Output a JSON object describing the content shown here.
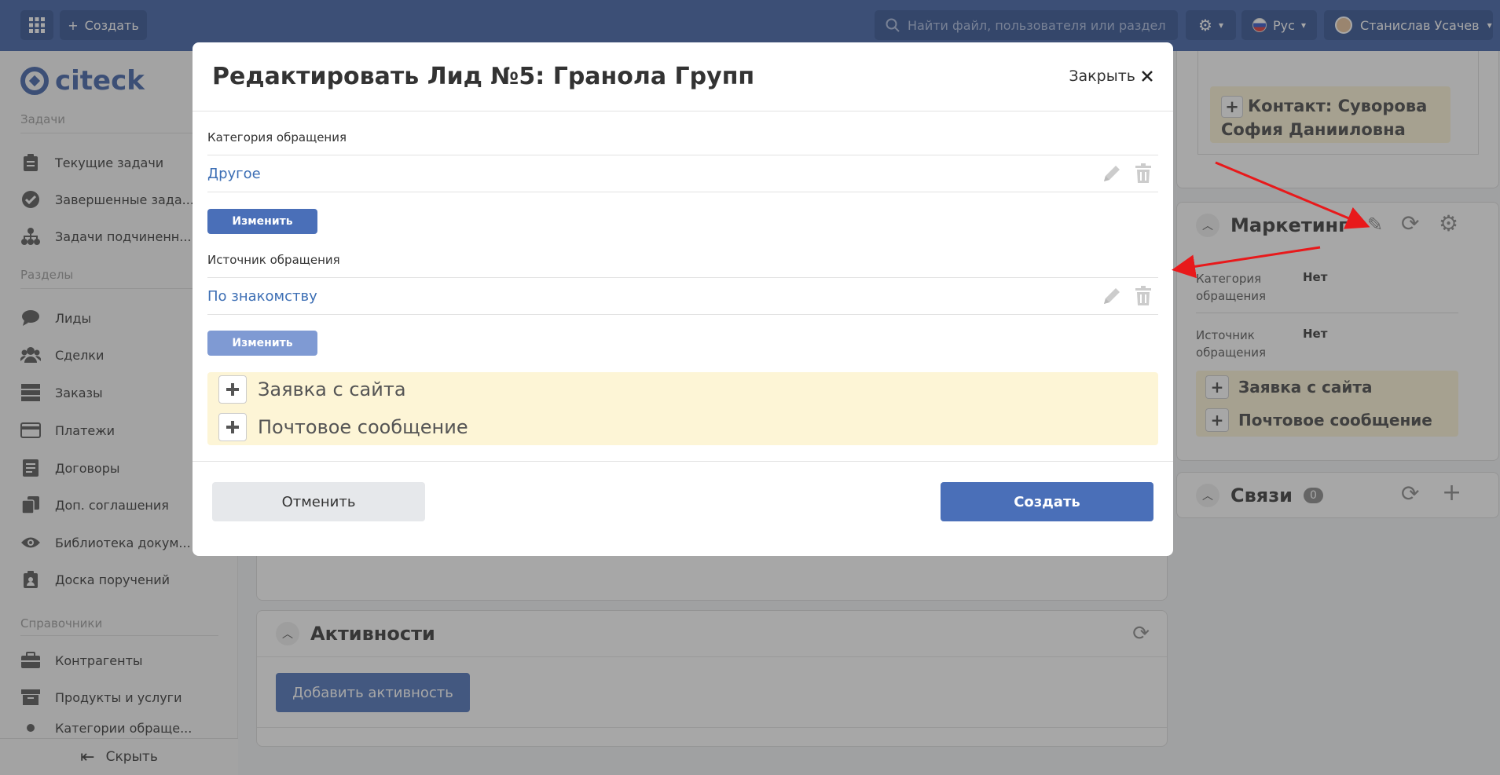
{
  "topbar": {
    "create_label": "Создать",
    "search_placeholder": "Найти файл, пользователя или раздел",
    "lang_label": "Рус",
    "user_name": "Станислав Усачев"
  },
  "sidebar": {
    "logo_text": "citeck",
    "heading_tasks": "Задачи",
    "heading_sections": "Разделы",
    "heading_refs": "Справочники",
    "items": [
      {
        "label": "Текущие задачи"
      },
      {
        "label": "Завершенные зада..."
      },
      {
        "label": "Задачи подчиненн..."
      },
      {
        "label": "Лиды"
      },
      {
        "label": "Сделки"
      },
      {
        "label": "Заказы"
      },
      {
        "label": "Платежи"
      },
      {
        "label": "Договоры"
      },
      {
        "label": "Доп. соглашения"
      },
      {
        "label": "Библиотека докум..."
      },
      {
        "label": "Доска поручений"
      },
      {
        "label": "Контрагенты"
      },
      {
        "label": "Продукты и услуги"
      },
      {
        "label": "Категории обраще..."
      }
    ],
    "hide_label": "Скрыть"
  },
  "background": {
    "activities_title": "Активности",
    "add_activity_label": "Добавить активность",
    "contact_text": "Контакт: Суворова София Данииловна",
    "marketing_title": "Маркетинг",
    "marketing_category_label": "Категория обращения",
    "marketing_category_value": "Нет",
    "marketing_source_label": "Источник обращения",
    "marketing_source_value": "Нет",
    "marketing_item1": "Заявка с сайта",
    "marketing_item2": "Почтовое сообщение",
    "links_title": "Связи",
    "links_count": "0"
  },
  "modal": {
    "title": "Редактировать Лид №5: Гранола Групп",
    "close_label": "Закрыть",
    "category_label": "Категория обращения",
    "category_value": "Другое",
    "source_label": "Источник обращения",
    "source_value": "По знакомству",
    "change_label": "Изменить",
    "add_items": [
      "Заявка с сайта",
      "Почтовое сообщение"
    ],
    "cancel_label": "Отменить",
    "create_label": "Создать"
  },
  "colors": {
    "topbar": "#3c5fa6",
    "primary_button": "#4a6fb8",
    "link": "#3c6eb4",
    "yellow_block": "#fdf5d6",
    "annotation_arrow": "#e8191b"
  }
}
